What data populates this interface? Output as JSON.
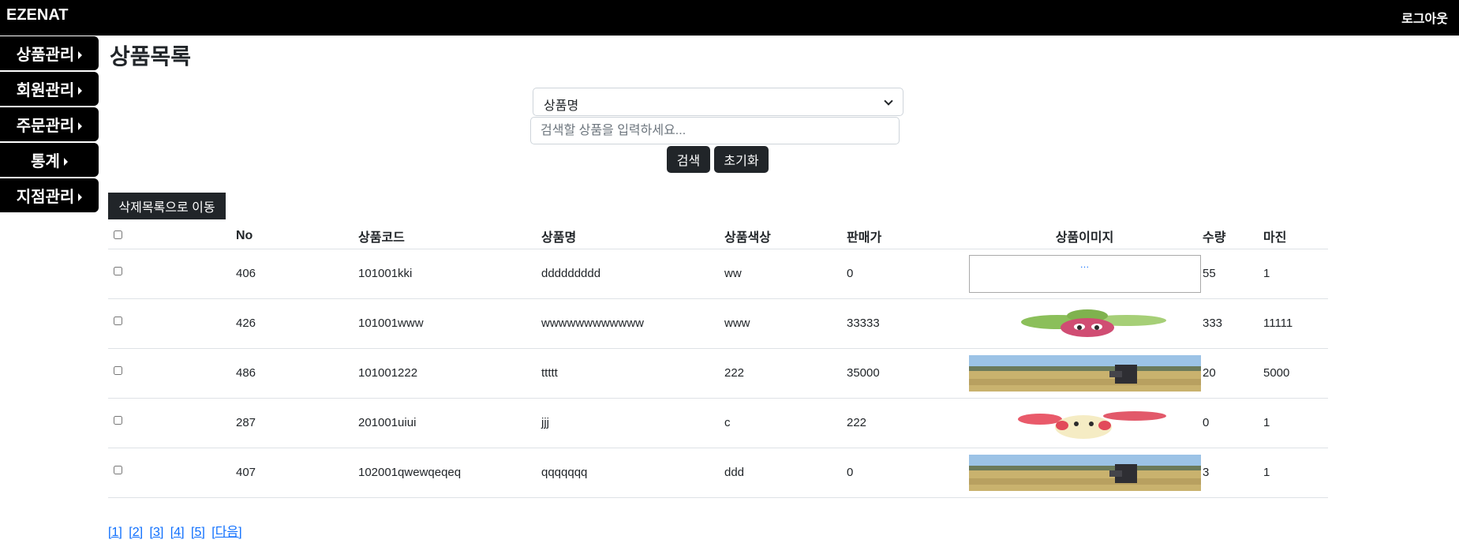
{
  "header": {
    "brand": "EZENAT",
    "logout_label": "로그아웃"
  },
  "sidebar": {
    "items": [
      {
        "label": "상품관리"
      },
      {
        "label": "회원관리"
      },
      {
        "label": "주문관리"
      },
      {
        "label": "통계"
      },
      {
        "label": "지점관리"
      }
    ]
  },
  "page_title": "상품목록",
  "search": {
    "type_selected": "상품명",
    "placeholder": "검색할 상품을 입력하세요...",
    "search_label": "검색",
    "reset_label": "초기화"
  },
  "trash_button_label": "삭제목록으로 이동",
  "table": {
    "headers": {
      "no": "No",
      "code": "상품코드",
      "name": "상품명",
      "color": "상품색상",
      "price": "판매가",
      "image": "상품이미지",
      "qty": "수량",
      "margin": "마진"
    },
    "rows": [
      {
        "no": "406",
        "code": "101001kki",
        "name": "ddddddddd",
        "color": "ww",
        "price": "0",
        "image": "broken",
        "qty": "55",
        "margin": "1"
      },
      {
        "no": "426",
        "code": "101001www",
        "name": "wwwwwwwwwwww",
        "color": "www",
        "price": "33333",
        "image": "plant-creature",
        "qty": "333",
        "margin": "11111"
      },
      {
        "no": "486",
        "code": "101001222",
        "name": "ttttt",
        "color": "222",
        "price": "35000",
        "image": "field-photo",
        "qty": "20",
        "margin": "5000"
      },
      {
        "no": "287",
        "code": "201001uiui",
        "name": "jjj",
        "color": "c",
        "price": "222",
        "image": "rabbit-creature",
        "qty": "0",
        "margin": "1"
      },
      {
        "no": "407",
        "code": "102001qwewqeqeq",
        "name": "qqqqqqq",
        "color": "ddd",
        "price": "0",
        "image": "field-photo",
        "qty": "3",
        "margin": "1"
      }
    ]
  },
  "pagination": {
    "pages": [
      "[1]",
      "[2]",
      "[3]",
      "[4]",
      "[5]"
    ],
    "next_label": "[다음]"
  },
  "colors": {
    "topbar": "#000000",
    "button": "#212529",
    "link": "#0d6efd"
  }
}
